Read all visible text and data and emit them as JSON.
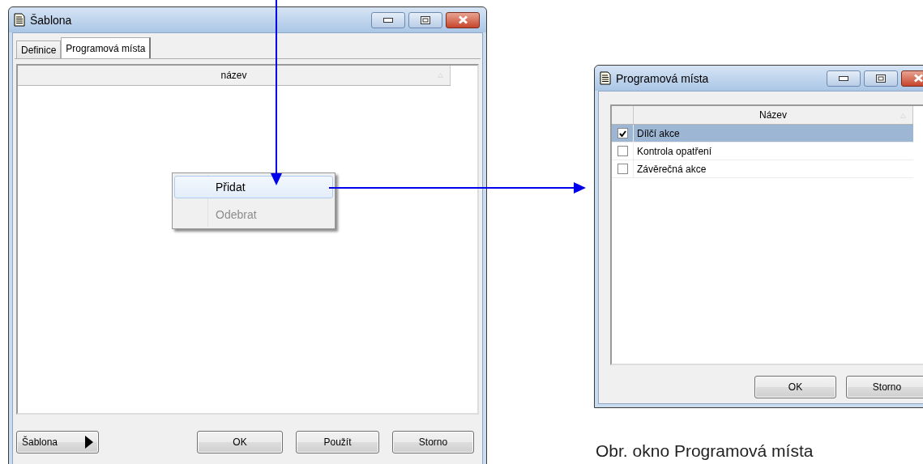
{
  "main_window": {
    "title": "Šablona",
    "tabs": [
      {
        "label": "Definice",
        "selected": false
      },
      {
        "label": "Programová místa",
        "selected": true
      }
    ],
    "columns": [
      "název"
    ],
    "context_menu": [
      {
        "label": "Přidat",
        "highlighted": true,
        "disabled": false
      },
      {
        "label": "Odebrat",
        "highlighted": false,
        "disabled": true
      }
    ],
    "template_button": "Šablona",
    "buttons": [
      "OK",
      "Použít",
      "Storno"
    ]
  },
  "dialog": {
    "title": "Programová místa",
    "columns": [
      "Název"
    ],
    "rows": [
      {
        "label": "Dílčí akce",
        "checked": true,
        "selected": true
      },
      {
        "label": "Kontrola opatření",
        "checked": false,
        "selected": false
      },
      {
        "label": "Závěrečná akce",
        "checked": false,
        "selected": false
      }
    ],
    "buttons": [
      "OK",
      "Storno"
    ]
  },
  "caption": "Obr. okno Programová místa"
}
